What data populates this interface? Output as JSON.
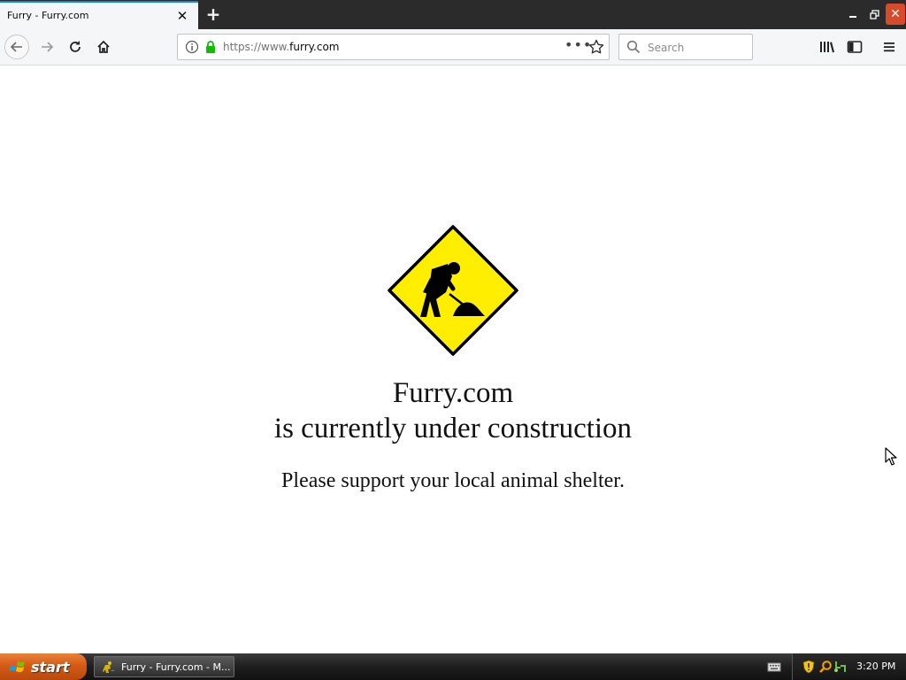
{
  "browser": {
    "tab": {
      "title": "Furry - Furry.com"
    },
    "urlbar": {
      "prefix": "https://www.",
      "domain": "furry.com"
    },
    "searchbar": {
      "placeholder": "Search"
    }
  },
  "page": {
    "title": "Furry.com",
    "subtitle": "is currently under construction",
    "message": "Please support your local animal shelter."
  },
  "taskbar": {
    "start_label": "start",
    "task_label": "Furry - Furry.com - M...",
    "clock": "3:20 PM"
  },
  "colors": {
    "tab_accent": "#0a84ff",
    "sign_yellow": "#ffee00",
    "start_button": "#d55a14",
    "lock_green": "#12bc00"
  },
  "icons": [
    "back-arrow-icon",
    "forward-arrow-icon",
    "reload-icon",
    "home-icon",
    "info-icon",
    "lock-icon",
    "more-icon",
    "bookmark-star-icon",
    "search-icon",
    "library-icon",
    "sidebar-icon",
    "hamburger-menu-icon",
    "construction-sign-icon"
  ]
}
